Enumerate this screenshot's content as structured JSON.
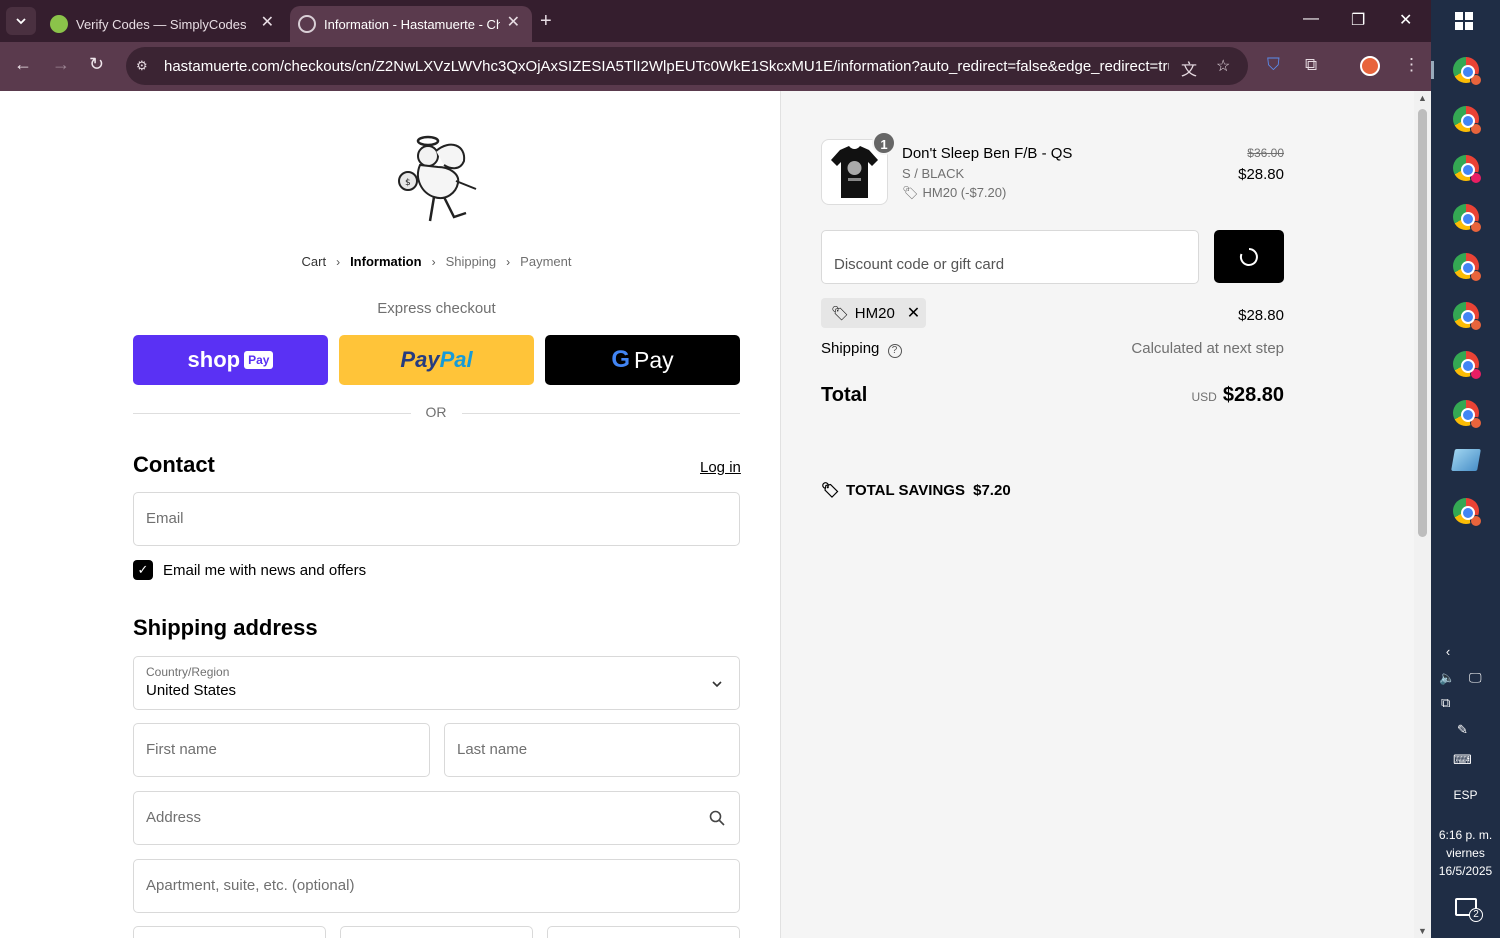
{
  "browser": {
    "tabs": [
      {
        "title": "Verify Codes — SimplyCodes"
      },
      {
        "title": "Information - Hastamuerte - Ch"
      }
    ],
    "url": "hastamuerte.com/checkouts/cn/Z2NwLXVzLWVhc3QxOjAxSIZESIA5TlI2WlpEUTc0WkE1SkcxMU1E/information?auto_redirect=false&edge_redirect=true&lo..."
  },
  "taskbar": {
    "language": "ESP",
    "time": "6:16 p. m.",
    "day": "viernes",
    "date": "16/5/2025",
    "notifications": "2"
  },
  "checkout": {
    "breadcrumb": [
      "Cart",
      "Information",
      "Shipping",
      "Payment"
    ],
    "express_label": "Express checkout",
    "shop_pay": {
      "word": "shop",
      "badge": "Pay"
    },
    "paypal": {
      "pay": "Pay",
      "pal": "Pal"
    },
    "gpay": {
      "g": "G",
      "pay": "Pay"
    },
    "or": "OR",
    "contact": {
      "heading": "Contact",
      "login": "Log in",
      "email_placeholder": "Email",
      "newsletter_label": "Email me with news and offers",
      "newsletter_checked": true
    },
    "shipping": {
      "heading": "Shipping address",
      "country_label": "Country/Region",
      "country_value": "United States",
      "first_name": "First name",
      "last_name": "Last name",
      "address": "Address",
      "apartment": "Apartment, suite, etc. (optional)"
    }
  },
  "summary": {
    "item": {
      "quantity": "1",
      "name": "Don't Sleep Ben F/B - QS",
      "variant": "S / BLACK",
      "discount": "HM20 (-$7.20)",
      "original_price": "$36.00",
      "price": "$28.80"
    },
    "discount_placeholder": "Discount code or gift card",
    "applied_code": "HM20",
    "subtotal": "$28.80",
    "shipping_label": "Shipping",
    "shipping_value": "Calculated at next step",
    "total_label": "Total",
    "currency": "USD",
    "total": "$28.80",
    "savings_label": "TOTAL SAVINGS",
    "savings_value": "$7.20"
  }
}
